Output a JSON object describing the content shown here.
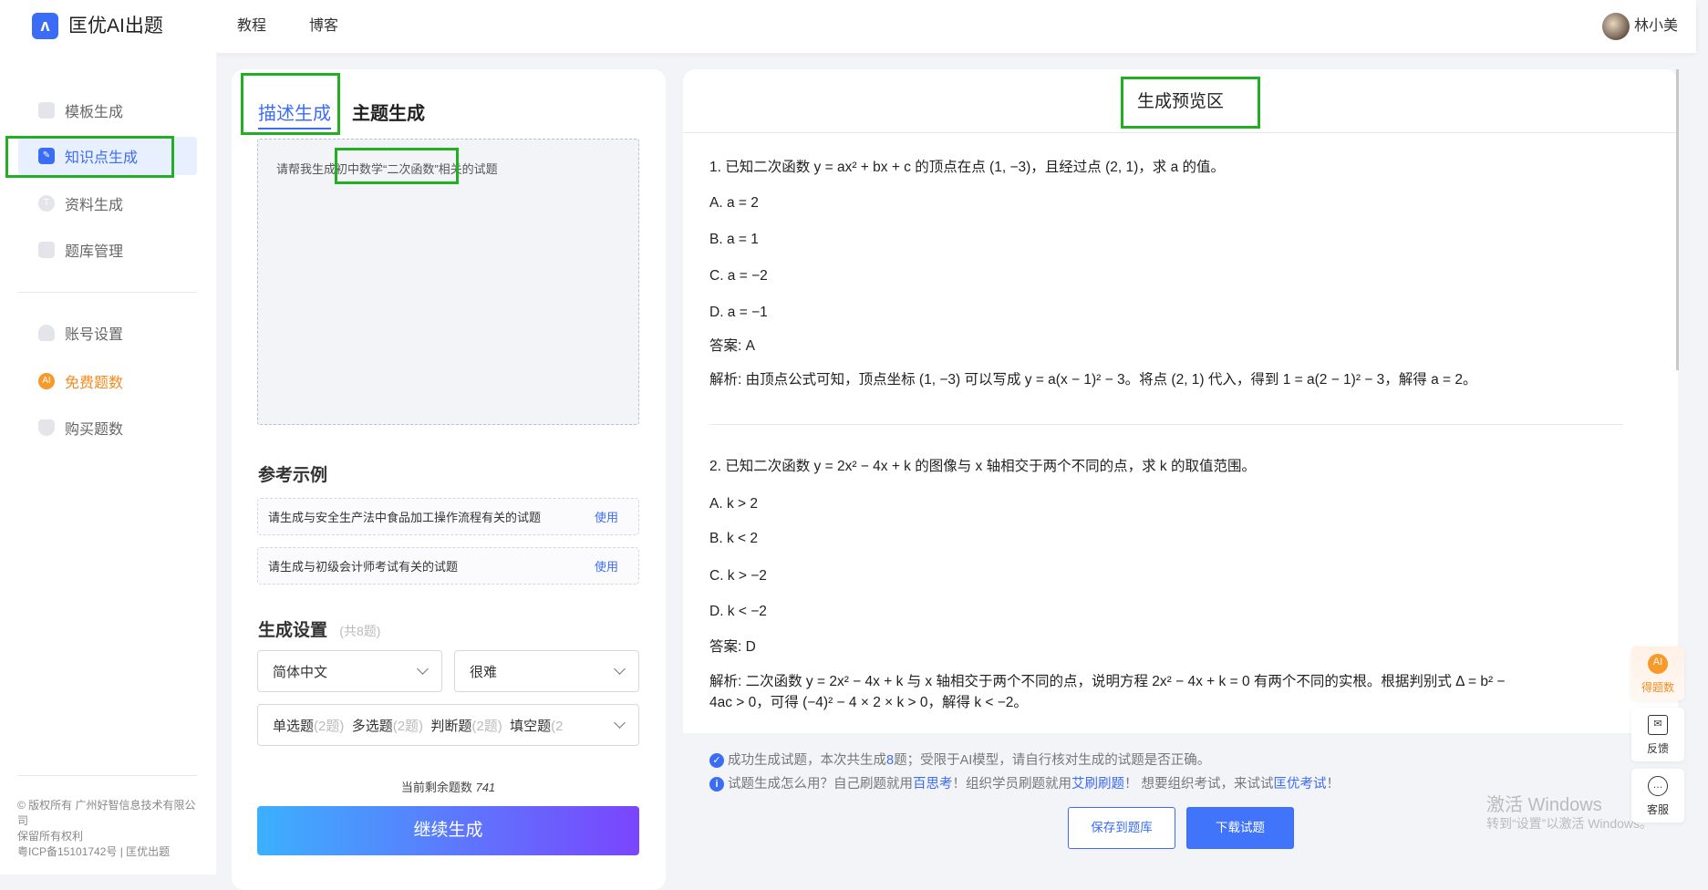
{
  "header": {
    "logo_glyph": "ʌ",
    "title": "匡优AI出题",
    "nav": [
      "教程",
      "博客"
    ],
    "user": "林小美"
  },
  "sidebar": {
    "items": [
      {
        "label": "模板生成",
        "icon": "template-icon"
      },
      {
        "label": "知识点生成",
        "icon": "pen-icon",
        "active": true
      },
      {
        "label": "资料生成",
        "icon": "text-icon"
      },
      {
        "label": "题库管理",
        "icon": "bank-icon"
      },
      {
        "label": "账号设置",
        "icon": "user-icon"
      },
      {
        "label": "免费题数",
        "icon": "ai-icon",
        "color": "#f58a1f"
      },
      {
        "label": "购买题数",
        "icon": "diamond-icon"
      }
    ],
    "ai_badge": "AI",
    "footer": [
      "© 版权所有 广州好智信息技术有限公",
      "司",
      "保留所有权利",
      "粤ICP备15101742号 | 匡优出题"
    ]
  },
  "left": {
    "tabs": [
      "描述生成",
      "主题生成"
    ],
    "prompt": "请帮我生成初中数学“二次函数”相关的试题",
    "examples_title": "参考示例",
    "examples": [
      {
        "text": "请生成与安全生产法中食品加工操作流程有关的试题",
        "action": "使用"
      },
      {
        "text": "请生成与初级会计师考试有关的试题",
        "action": "使用"
      }
    ],
    "settings_title": "生成设置",
    "settings_count": "(共8题)",
    "language": "简体中文",
    "difficulty": "很难",
    "types": [
      {
        "name": "单选题",
        "count": "(2题)"
      },
      {
        "name": "多选题",
        "count": "(2题)"
      },
      {
        "name": "判断题",
        "count": "(2题)"
      },
      {
        "name": "填空题",
        "count": "(2"
      }
    ],
    "remaining_label": "当前剩余题数",
    "remaining": "741",
    "generate_button": "继续生成"
  },
  "preview": {
    "title": "生成预览区",
    "q1": [
      "1. 已知二次函数 y = ax² + bx + c 的顶点在点 (1, −3)，且经过点 (2, 1)，求 a 的值。",
      "A. a = 2",
      "B. a = 1",
      "C. a = −2",
      "D. a = −1",
      "答案: A",
      "解析: 由顶点公式可知，顶点坐标 (1, −3) 可以写成 y = a(x − 1)² − 3。将点 (2, 1) 代入，得到 1 = a(2 − 1)² − 3，解得 a = 2。"
    ],
    "q2": [
      "2. 已知二次函数 y = 2x² − 4x + k 的图像与 x 轴相交于两个不同的点，求 k 的取值范围。",
      "A. k > 2",
      "B. k < 2",
      "C. k > −2",
      "D. k < −2",
      "答案: D",
      "解析: 二次函数 y = 2x² − 4x + k 与 x 轴相交于两个不同的点，说明方程 2x² − 4x + k = 0 有两个不同的实根。根据判别式 Δ = b² −",
      "4ac > 0，可得 (−4)² − 4 × 2 × k > 0，解得 k < −2。"
    ]
  },
  "bottom": {
    "msg1_a": "成功生成试题，本次共生成 ",
    "msg1_count": "8",
    "msg1_b": " 题；受限于AI模型，请自行核对生成的试题是否正确。",
    "msg2_a": "试题生成怎么用？自己刷题就用",
    "link1": "百思考",
    "msg2_b": "！组织学员刷题就用",
    "link2": "艾刷刷题",
    "msg2_c": "！ 想要组织考试，来试试",
    "link3": "匡优考试",
    "msg2_d": "！",
    "save_button": "保存到题库",
    "download_button": "下载试题"
  },
  "float": [
    {
      "label": "得题数",
      "icon": "ai-icon"
    },
    {
      "label": "反馈",
      "icon": "mail-icon"
    },
    {
      "label": "客服",
      "icon": "chat-icon"
    }
  ],
  "watermark": {
    "line1": "激活 Windows",
    "line2": "转到“设置”以激活 Windows。"
  },
  "colors": {
    "accent": "#3b6cf6",
    "highlight": "#22b022",
    "orange": "#f58a1f"
  }
}
